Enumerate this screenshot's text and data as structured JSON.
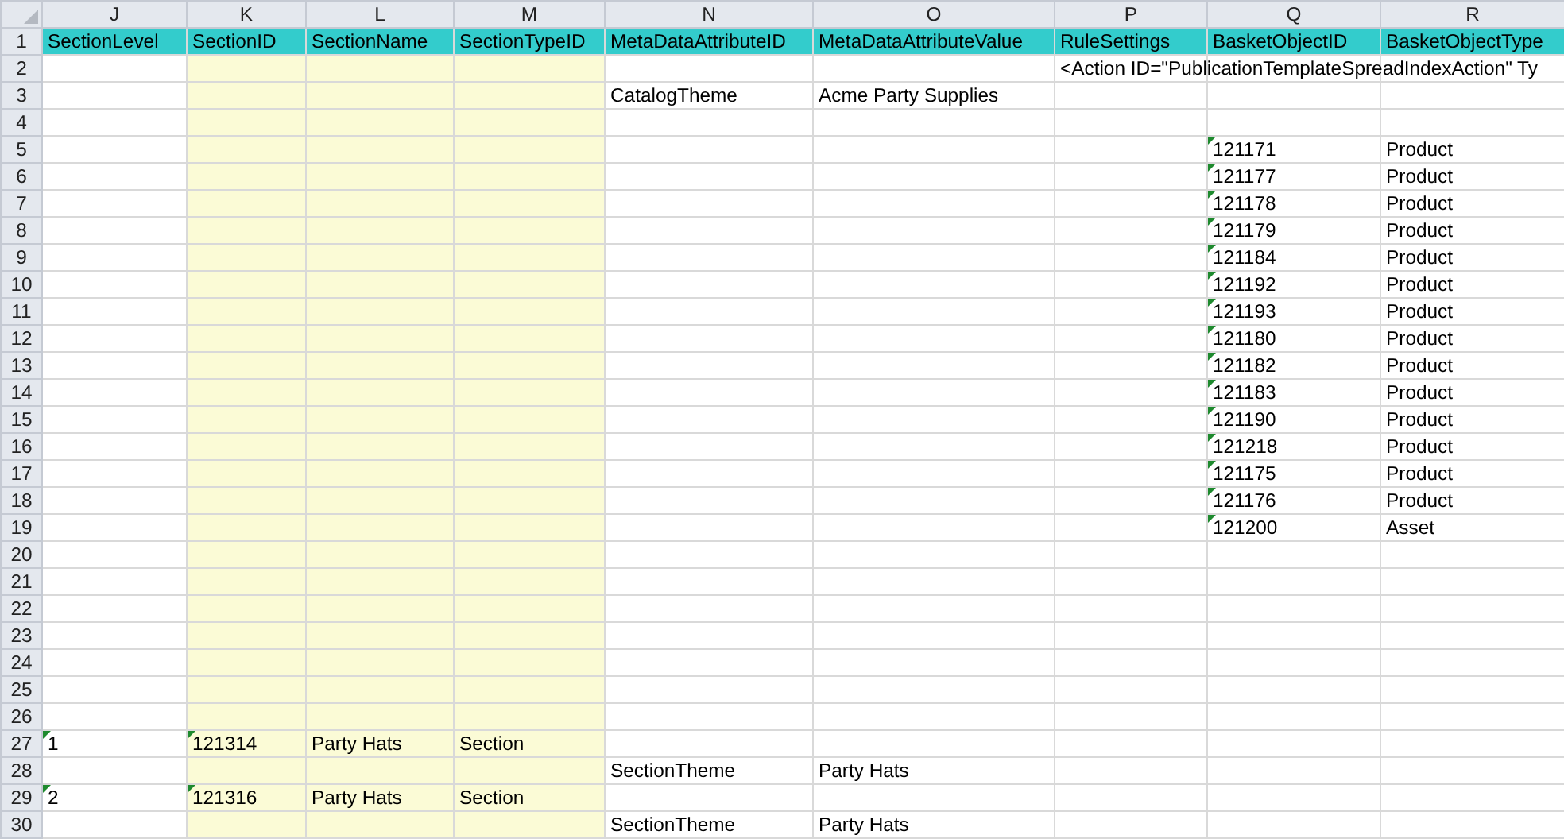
{
  "columns": [
    {
      "letter": "J",
      "highlighted": false
    },
    {
      "letter": "K",
      "highlighted": true
    },
    {
      "letter": "L",
      "highlighted": true
    },
    {
      "letter": "M",
      "highlighted": true
    },
    {
      "letter": "N",
      "highlighted": false
    },
    {
      "letter": "O",
      "highlighted": false
    },
    {
      "letter": "P",
      "highlighted": false
    },
    {
      "letter": "Q",
      "highlighted": false
    },
    {
      "letter": "R",
      "highlighted": false
    }
  ],
  "rows": [
    {
      "number": "1",
      "header": true,
      "cells": [
        {
          "text": "SectionLevel"
        },
        {
          "text": "SectionID"
        },
        {
          "text": "SectionName"
        },
        {
          "text": "SectionTypeID"
        },
        {
          "text": "MetaDataAttributeID"
        },
        {
          "text": "MetaDataAttributeValue"
        },
        {
          "text": "RuleSettings"
        },
        {
          "text": "BasketObjectID"
        },
        {
          "text": "BasketObjectType"
        }
      ]
    },
    {
      "number": "2",
      "header": false,
      "cells": [
        {},
        {},
        {},
        {},
        {},
        {},
        {
          "text": "<Action ID=\"PublicationTemplateSpreadIndexAction\" Ty"
        },
        {},
        {}
      ]
    },
    {
      "number": "3",
      "header": false,
      "cells": [
        {},
        {},
        {},
        {},
        {
          "text": "CatalogTheme"
        },
        {
          "text": "Acme Party Supplies"
        },
        {},
        {},
        {}
      ]
    },
    {
      "number": "4",
      "header": false,
      "cells": [
        {},
        {},
        {},
        {},
        {},
        {},
        {},
        {},
        {}
      ]
    },
    {
      "number": "5",
      "header": false,
      "cells": [
        {},
        {},
        {},
        {},
        {},
        {},
        {},
        {
          "text": "121171",
          "flagged": true
        },
        {
          "text": "Product"
        }
      ]
    },
    {
      "number": "6",
      "header": false,
      "cells": [
        {},
        {},
        {},
        {},
        {},
        {},
        {},
        {
          "text": "121177",
          "flagged": true
        },
        {
          "text": "Product"
        }
      ]
    },
    {
      "number": "7",
      "header": false,
      "cells": [
        {},
        {},
        {},
        {},
        {},
        {},
        {},
        {
          "text": "121178",
          "flagged": true
        },
        {
          "text": "Product"
        }
      ]
    },
    {
      "number": "8",
      "header": false,
      "cells": [
        {},
        {},
        {},
        {},
        {},
        {},
        {},
        {
          "text": "121179",
          "flagged": true
        },
        {
          "text": "Product"
        }
      ]
    },
    {
      "number": "9",
      "header": false,
      "cells": [
        {},
        {},
        {},
        {},
        {},
        {},
        {},
        {
          "text": "121184",
          "flagged": true
        },
        {
          "text": "Product"
        }
      ]
    },
    {
      "number": "10",
      "header": false,
      "cells": [
        {},
        {},
        {},
        {},
        {},
        {},
        {},
        {
          "text": "121192",
          "flagged": true
        },
        {
          "text": "Product"
        }
      ]
    },
    {
      "number": "11",
      "header": false,
      "cells": [
        {},
        {},
        {},
        {},
        {},
        {},
        {},
        {
          "text": "121193",
          "flagged": true
        },
        {
          "text": "Product"
        }
      ]
    },
    {
      "number": "12",
      "header": false,
      "cells": [
        {},
        {},
        {},
        {},
        {},
        {},
        {},
        {
          "text": "121180",
          "flagged": true
        },
        {
          "text": "Product"
        }
      ]
    },
    {
      "number": "13",
      "header": false,
      "cells": [
        {},
        {},
        {},
        {},
        {},
        {},
        {},
        {
          "text": "121182",
          "flagged": true
        },
        {
          "text": "Product"
        }
      ]
    },
    {
      "number": "14",
      "header": false,
      "cells": [
        {},
        {},
        {},
        {},
        {},
        {},
        {},
        {
          "text": "121183",
          "flagged": true
        },
        {
          "text": "Product"
        }
      ]
    },
    {
      "number": "15",
      "header": false,
      "cells": [
        {},
        {},
        {},
        {},
        {},
        {},
        {},
        {
          "text": "121190",
          "flagged": true
        },
        {
          "text": "Product"
        }
      ]
    },
    {
      "number": "16",
      "header": false,
      "cells": [
        {},
        {},
        {},
        {},
        {},
        {},
        {},
        {
          "text": "121218",
          "flagged": true
        },
        {
          "text": "Product"
        }
      ]
    },
    {
      "number": "17",
      "header": false,
      "cells": [
        {},
        {},
        {},
        {},
        {},
        {},
        {},
        {
          "text": "121175",
          "flagged": true
        },
        {
          "text": "Product"
        }
      ]
    },
    {
      "number": "18",
      "header": false,
      "cells": [
        {},
        {},
        {},
        {},
        {},
        {},
        {},
        {
          "text": "121176",
          "flagged": true
        },
        {
          "text": "Product"
        }
      ]
    },
    {
      "number": "19",
      "header": false,
      "cells": [
        {},
        {},
        {},
        {},
        {},
        {},
        {},
        {
          "text": "121200",
          "flagged": true
        },
        {
          "text": "Asset"
        }
      ]
    },
    {
      "number": "20",
      "header": false,
      "cells": [
        {},
        {},
        {},
        {},
        {},
        {},
        {},
        {},
        {}
      ]
    },
    {
      "number": "21",
      "header": false,
      "cells": [
        {},
        {},
        {},
        {},
        {},
        {},
        {},
        {},
        {}
      ]
    },
    {
      "number": "22",
      "header": false,
      "cells": [
        {},
        {},
        {},
        {},
        {},
        {},
        {},
        {},
        {}
      ]
    },
    {
      "number": "23",
      "header": false,
      "cells": [
        {},
        {},
        {},
        {},
        {},
        {},
        {},
        {},
        {}
      ]
    },
    {
      "number": "24",
      "header": false,
      "cells": [
        {},
        {},
        {},
        {},
        {},
        {},
        {},
        {},
        {}
      ]
    },
    {
      "number": "25",
      "header": false,
      "cells": [
        {},
        {},
        {},
        {},
        {},
        {},
        {},
        {},
        {}
      ]
    },
    {
      "number": "26",
      "header": false,
      "cells": [
        {},
        {},
        {},
        {},
        {},
        {},
        {},
        {},
        {}
      ]
    },
    {
      "number": "27",
      "header": false,
      "cells": [
        {
          "text": "1",
          "flagged": true
        },
        {
          "text": "121314",
          "flagged": true
        },
        {
          "text": "Party Hats"
        },
        {
          "text": "Section"
        },
        {},
        {},
        {},
        {},
        {}
      ]
    },
    {
      "number": "28",
      "header": false,
      "cells": [
        {},
        {},
        {},
        {},
        {
          "text": "SectionTheme"
        },
        {
          "text": "Party Hats"
        },
        {},
        {},
        {}
      ]
    },
    {
      "number": "29",
      "header": false,
      "cells": [
        {
          "text": "2",
          "flagged": true
        },
        {
          "text": "121316",
          "flagged": true
        },
        {
          "text": "Party Hats"
        },
        {
          "text": "Section"
        },
        {},
        {},
        {},
        {},
        {}
      ]
    },
    {
      "number": "30",
      "header": false,
      "cells": [
        {},
        {},
        {},
        {},
        {
          "text": "SectionTheme"
        },
        {
          "text": "Party Hats"
        },
        {},
        {},
        {}
      ]
    }
  ]
}
